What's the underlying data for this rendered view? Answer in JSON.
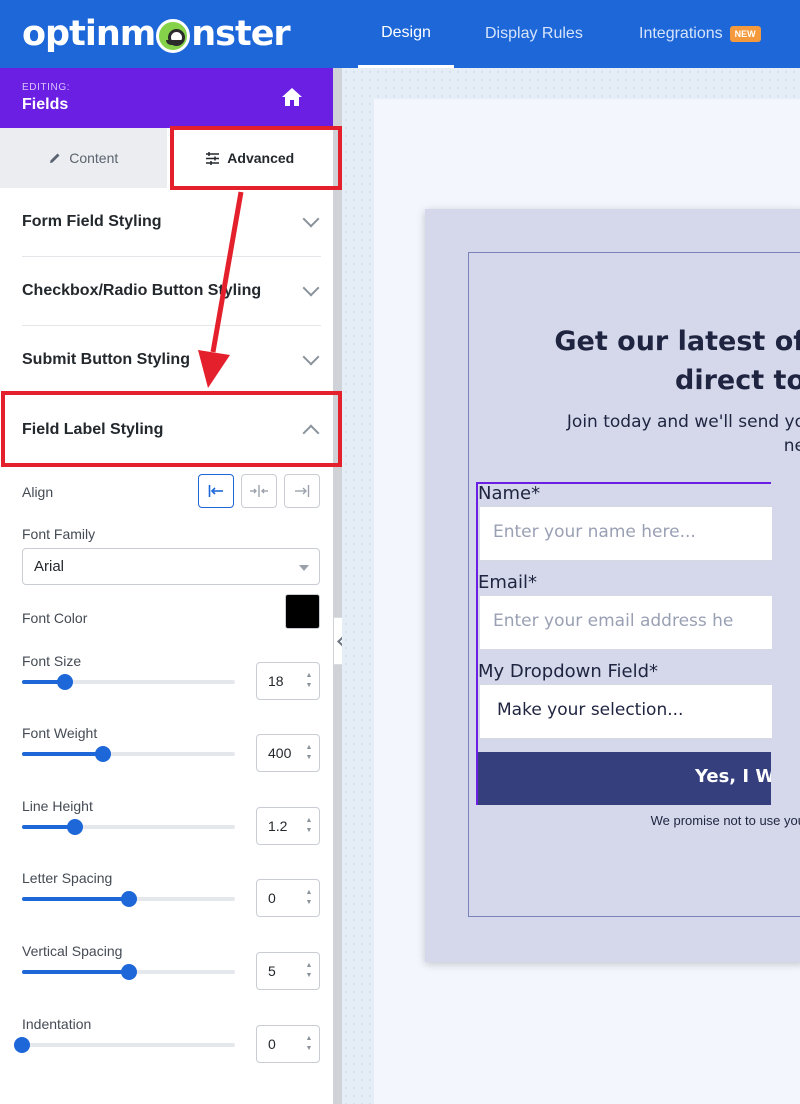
{
  "topbar": {
    "logo_left": "optinm",
    "logo_right": "nster",
    "nav": [
      "Design",
      "Display Rules",
      "Integrations"
    ],
    "badge": "NEW"
  },
  "sidebar": {
    "editing_label": "EDITING:",
    "editing_title": "Fields",
    "tabs": [
      "Content",
      "Advanced"
    ],
    "sections": [
      "Form Field Styling",
      "Checkbox/Radio Button Styling",
      "Submit Button Styling",
      "Field Label Styling"
    ],
    "align_label": "Align",
    "font_family_label": "Font Family",
    "font_family_value": "Arial",
    "font_color_label": "Font Color",
    "font_color": "#000000",
    "sliders": [
      {
        "label": "Font Size",
        "value": "18",
        "fraction": 0.2
      },
      {
        "label": "Font Weight",
        "value": "400",
        "fraction": 0.38
      },
      {
        "label": "Line Height",
        "value": "1.2",
        "fraction": 0.25
      },
      {
        "label": "Letter Spacing",
        "value": "0",
        "fraction": 0.5
      },
      {
        "label": "Vertical Spacing",
        "value": "5",
        "fraction": 0.5
      },
      {
        "label": "Indentation",
        "value": "0",
        "fraction": 0.0
      }
    ]
  },
  "preview": {
    "headline_1": "Get our latest of",
    "headline_2": "direct to",
    "sub_1": "Join today and we'll send yo",
    "sub_2": "ne",
    "fields": [
      {
        "label": "Name*",
        "placeholder": "Enter your name here..."
      },
      {
        "label": "Email*",
        "placeholder": "Enter your email address he"
      },
      {
        "label": "My Dropdown Field*",
        "placeholder": "Make your selection..."
      }
    ],
    "submit": "Yes, I W",
    "privacy": "We promise not to use you"
  },
  "colors": {
    "brand_blue": "#1d67d9",
    "editing_purple": "#6b1fe3",
    "annotation_red": "#e5202d",
    "submit_navy": "#353f7e"
  }
}
